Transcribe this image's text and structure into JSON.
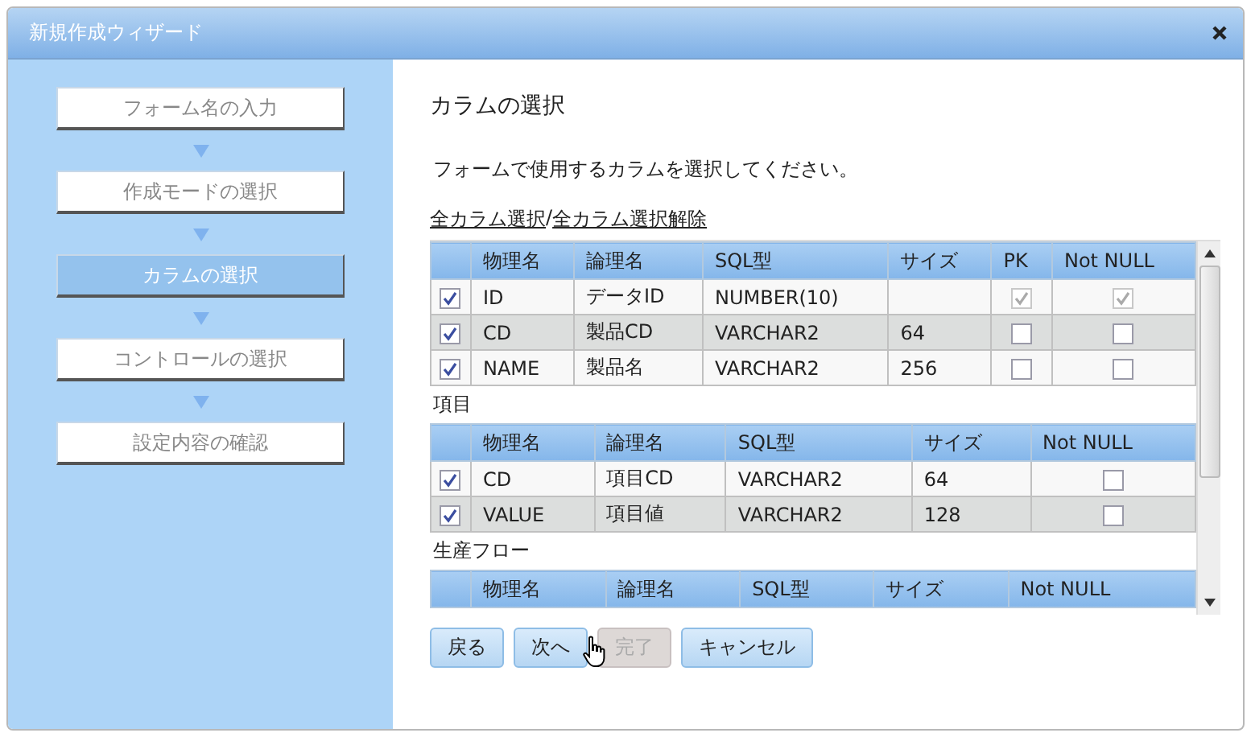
{
  "window": {
    "title": "新規作成ウィザード"
  },
  "steps": [
    {
      "label": "フォーム名の入力",
      "selected": false
    },
    {
      "label": "作成モードの選択",
      "selected": false
    },
    {
      "label": "カラムの選択",
      "selected": true
    },
    {
      "label": "コントロールの選択",
      "selected": false
    },
    {
      "label": "設定内容の確認",
      "selected": false
    }
  ],
  "page": {
    "heading": "カラムの選択",
    "instruction": "フォームで使用するカラムを選択してください。",
    "select_all_link": "全カラム選択",
    "separator": "/",
    "deselect_all_link": "全カラム選択解除"
  },
  "tables": [
    {
      "columns": [
        "物理名",
        "論理名",
        "SQL型",
        "サイズ",
        "PK",
        "Not NULL"
      ],
      "rows": [
        {
          "checked": true,
          "cells": [
            "ID",
            "データID",
            "NUMBER(10)",
            ""
          ],
          "flags": [
            {
              "checked": true,
              "disabled": true
            },
            {
              "checked": true,
              "disabled": true
            }
          ]
        },
        {
          "checked": true,
          "cells": [
            "CD",
            "製品CD",
            "VARCHAR2",
            "64"
          ],
          "flags": [
            {
              "checked": false,
              "disabled": false
            },
            {
              "checked": false,
              "disabled": false
            }
          ]
        },
        {
          "checked": true,
          "cells": [
            "NAME",
            "製品名",
            "VARCHAR2",
            "256"
          ],
          "flags": [
            {
              "checked": false,
              "disabled": false
            },
            {
              "checked": false,
              "disabled": false
            }
          ]
        }
      ]
    },
    {
      "caption": "項目",
      "columns": [
        "物理名",
        "論理名",
        "SQL型",
        "サイズ",
        "Not NULL"
      ],
      "rows": [
        {
          "checked": true,
          "cells": [
            "CD",
            "項目CD",
            "VARCHAR2",
            "64"
          ],
          "flags": [
            {
              "checked": false,
              "disabled": false
            }
          ]
        },
        {
          "checked": true,
          "cells": [
            "VALUE",
            "項目値",
            "VARCHAR2",
            "128"
          ],
          "flags": [
            {
              "checked": false,
              "disabled": false
            }
          ]
        }
      ]
    },
    {
      "caption": "生産フロー",
      "columns": [
        "物理名",
        "論理名",
        "SQL型",
        "サイズ",
        "Not NULL"
      ]
    }
  ],
  "buttons": [
    {
      "label": "戻る",
      "disabled": false
    },
    {
      "label": "次へ",
      "disabled": false
    },
    {
      "label": "完了",
      "disabled": true
    },
    {
      "label": "キャンセル",
      "disabled": false
    }
  ]
}
